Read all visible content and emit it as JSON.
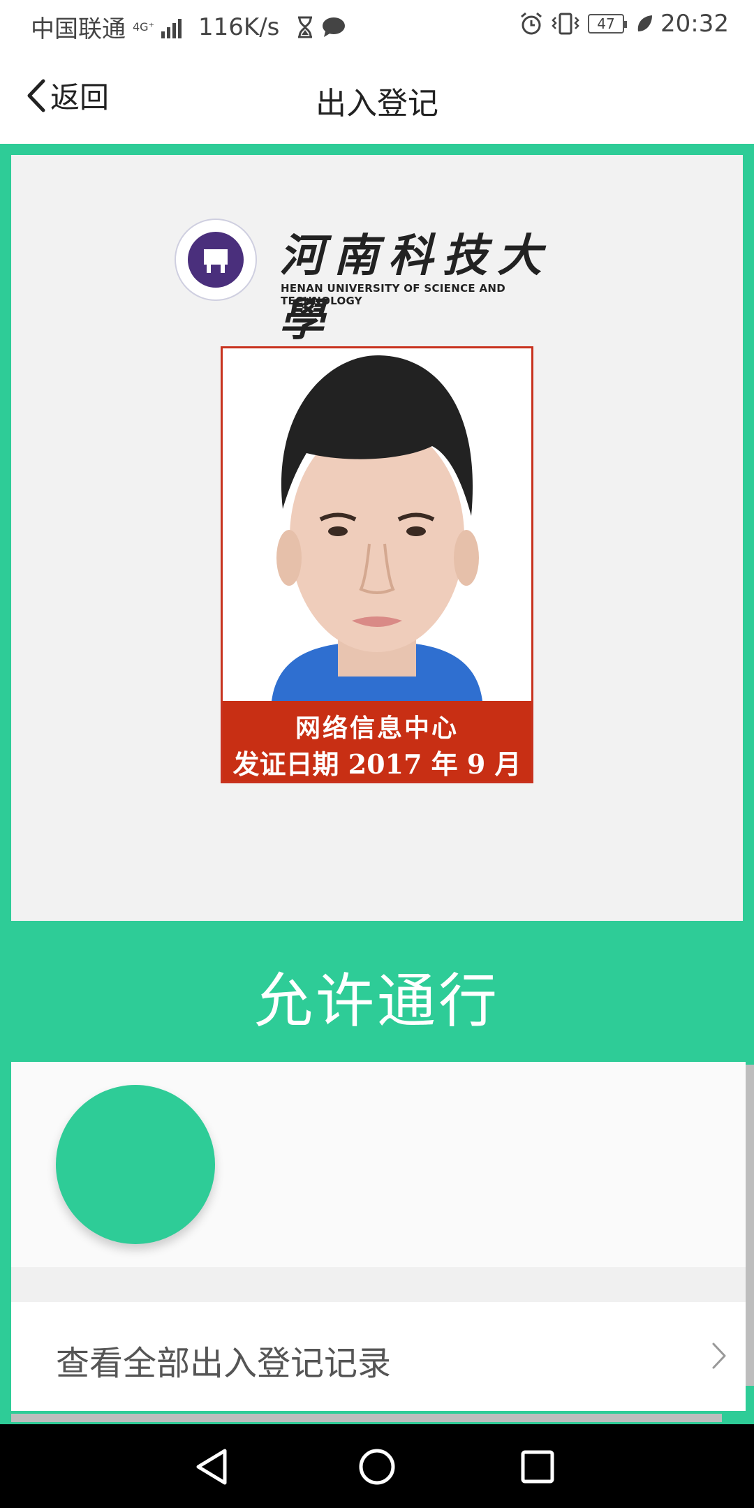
{
  "status_bar": {
    "carrier": "中国联通",
    "network": "4G⁺",
    "speed": "116K/s",
    "battery": "47",
    "time": "20:32"
  },
  "nav": {
    "back_label": "返回",
    "title": "出入登记"
  },
  "card": {
    "university_cn": "河南科技大學",
    "university_en": "HENAN UNIVERSITY OF SCIENCE AND TECHNOLOGY",
    "photo_caption_line1": "网络信息中心",
    "photo_caption_line2": "发证日期 2017 年 9 月"
  },
  "status": {
    "text": "允许通行"
  },
  "records": {
    "label": "查看全部出入登记记录"
  },
  "colors": {
    "accent": "#2ecc97",
    "caption_red": "#c82f14"
  },
  "icons": {
    "back": "chevron-left-icon",
    "records": "chevron-right-icon",
    "sys_back": "triangle-back-icon",
    "sys_home": "circle-home-icon",
    "sys_recent": "square-recent-icon"
  }
}
